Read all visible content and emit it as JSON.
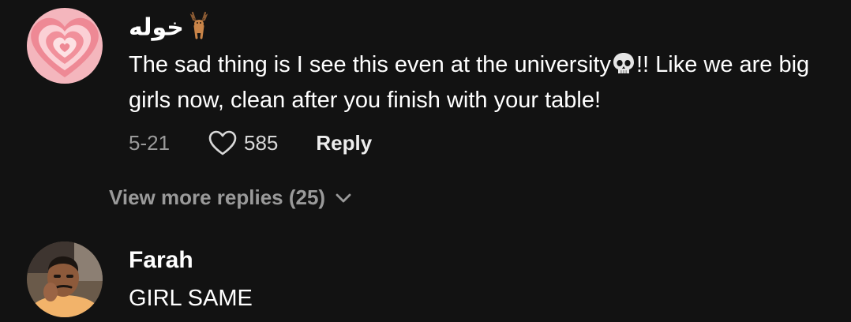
{
  "comments": [
    {
      "username": "خوله",
      "username_emoji": "deer-emoji",
      "text_part1": "The sad thing is I see this even at the university",
      "text_emoji": "skull-emoji",
      "text_part2": "!! Like we are big girls now, clean after you finish with your table!",
      "date": "5-21",
      "likes": "585",
      "reply_label": "Reply",
      "view_more_replies": "View more replies (25)",
      "avatar": "pink-heart-avatar"
    },
    {
      "username": "Farah",
      "text": "GIRL SAME",
      "avatar": "man-photo-avatar"
    }
  ],
  "icons": {
    "like": "heart-outline-icon",
    "expand": "chevron-down-icon"
  },
  "colors": {
    "background": "#121212",
    "text_primary": "#ffffff",
    "text_secondary": "#9a9a9a"
  }
}
